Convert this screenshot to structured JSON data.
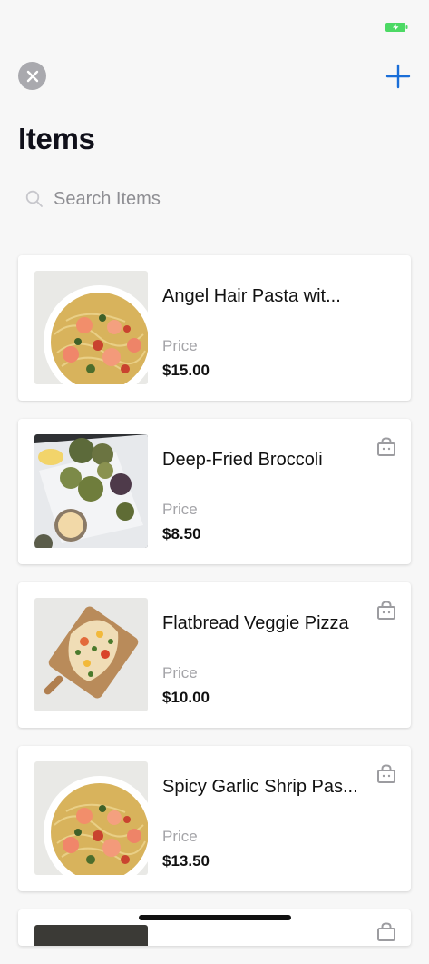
{
  "status_bar": {
    "battery_color": "#4cd964"
  },
  "header": {
    "close_icon": "close-icon",
    "add_icon": "plus-icon",
    "accent_color": "#1a6ed8",
    "title": "Items"
  },
  "search": {
    "placeholder": "Search Items",
    "value": ""
  },
  "items": [
    {
      "name": "Angel Hair Pasta wit...",
      "price_label": "Price",
      "price": "$15.00",
      "image": "shrimp-pasta",
      "bag_icon": false
    },
    {
      "name": "Deep-Fried Broccoli",
      "price_label": "Price",
      "price": "$8.50",
      "image": "fried-broccoli",
      "bag_icon": true
    },
    {
      "name": "Flatbread Veggie Pizza",
      "price_label": "Price",
      "price": "$10.00",
      "image": "flatbread-pizza",
      "bag_icon": true
    },
    {
      "name": "Spicy Garlic Shrip Pas...",
      "price_label": "Price",
      "price": "$13.50",
      "image": "shrimp-pasta",
      "bag_icon": true
    }
  ]
}
